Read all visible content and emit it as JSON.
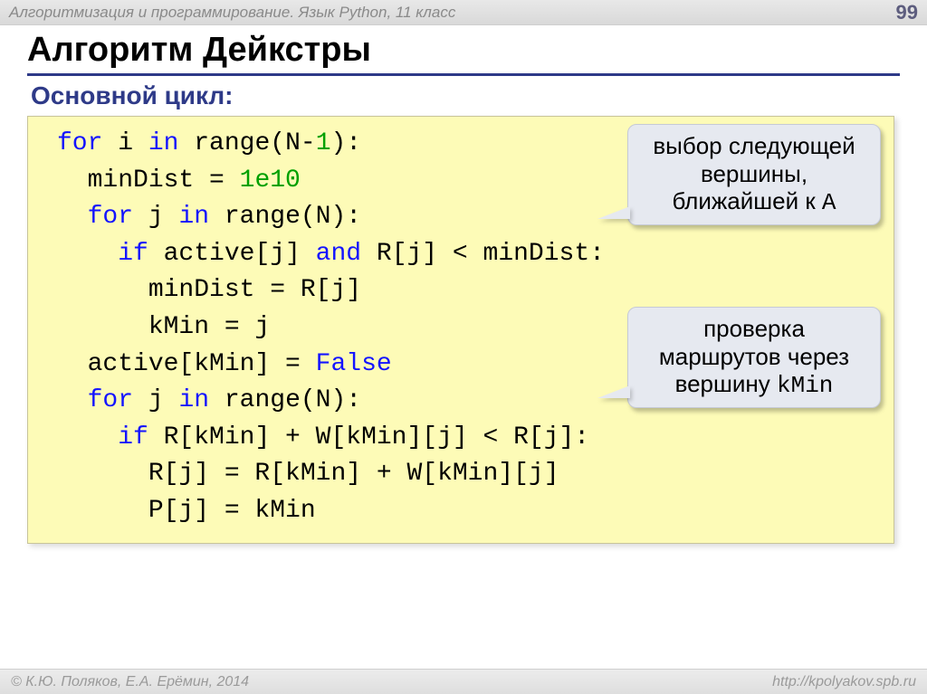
{
  "header": {
    "breadcrumb": "Алгоритмизация и программирование. Язык Python, 11 класс",
    "page": "99"
  },
  "title": "Алгоритм Дейкстры",
  "subtitle": "Основной цикл:",
  "code": {
    "l1a": "for",
    "l1b": " i ",
    "l1c": "in",
    "l1d": " range(N-",
    "l1e": "1",
    "l1f": "):",
    "l2a": "  minDist = ",
    "l2b": "1e10",
    "l3a": "  ",
    "l3b": "for",
    "l3c": " j ",
    "l3d": "in",
    "l3e": " range(N):",
    "l4a": "    ",
    "l4b": "if",
    "l4c": " active[j] ",
    "l4d": "and",
    "l4e": " R[j] < minDist:",
    "l5": "      minDist = R[j]",
    "l6": "      kMin = j",
    "l7a": "  active[kMin] = ",
    "l7b": "False",
    "l8a": "  ",
    "l8b": "for",
    "l8c": " j ",
    "l8d": "in",
    "l8e": " range(N):",
    "l9a": "    ",
    "l9b": "if",
    "l9c": " R[kMin] + W[kMin][j] < R[j]:",
    "l10": "      R[j] = R[kMin] + W[kMin][j]",
    "l11": "      P[j] = kMin"
  },
  "callouts": {
    "c1_line1": "выбор следующей",
    "c1_line2": "вершины,",
    "c1_line3a": "ближайшей к ",
    "c1_line3b": "A",
    "c2_line1": "проверка",
    "c2_line2": "маршрутов через",
    "c2_line3a": "вершину ",
    "c2_line3b": "kMin"
  },
  "footer": {
    "left": "© К.Ю. Поляков, Е.А. Ерёмин, 2014",
    "right": "http://kpolyakov.spb.ru"
  }
}
